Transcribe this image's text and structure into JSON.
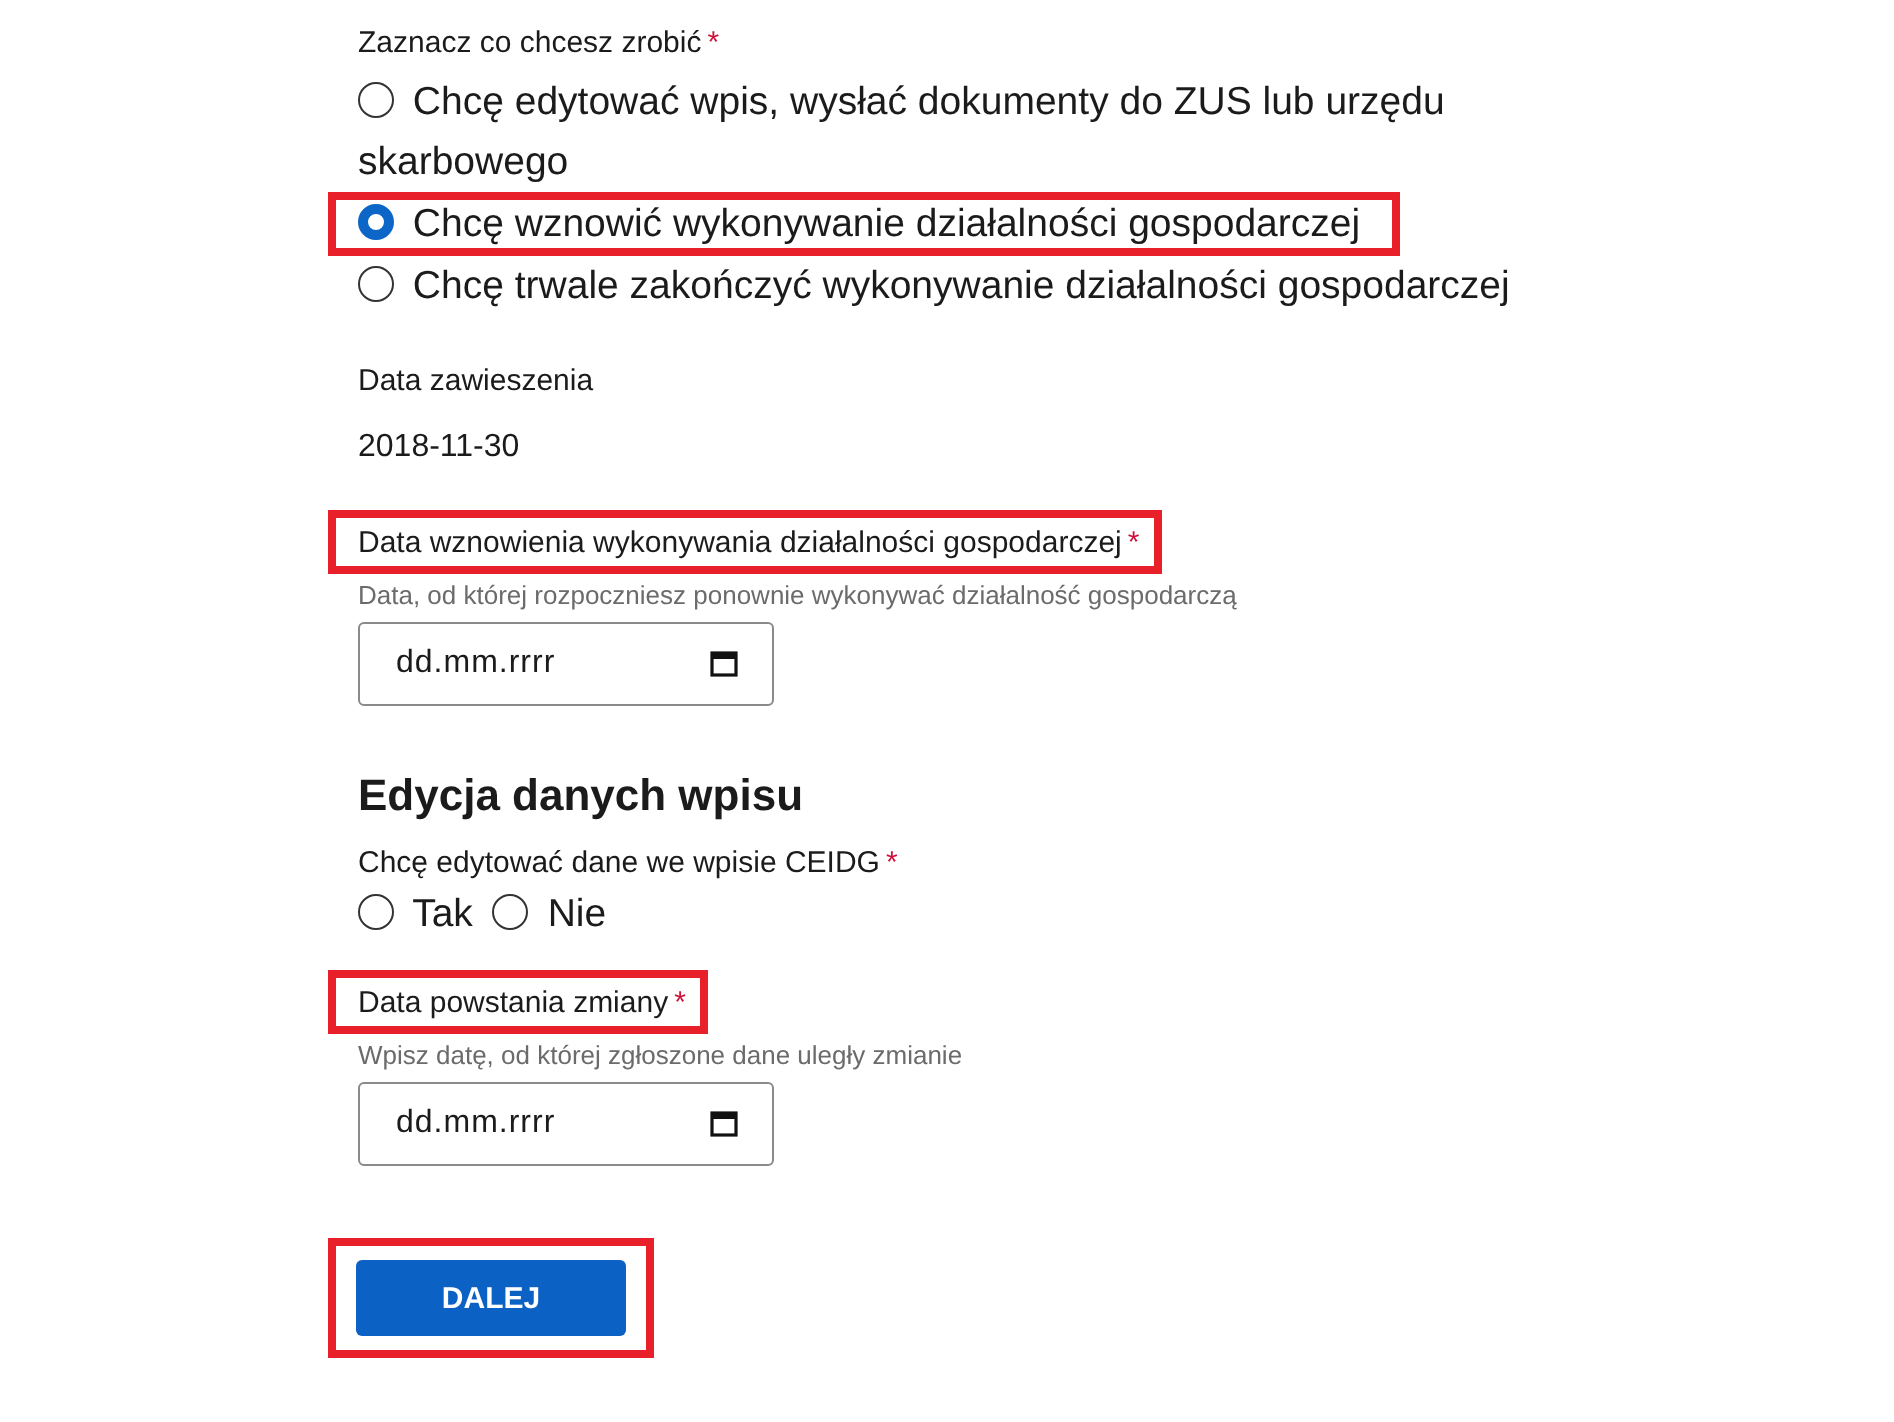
{
  "action_question": {
    "label": "Zaznacz co chcesz zrobić",
    "required_mark": "*",
    "options": [
      {
        "label": "Chcę edytować wpis, wysłać dokumenty do ZUS lub urzędu skarbowego",
        "selected": false,
        "highlighted": false
      },
      {
        "label": "Chcę wznowić wykonywanie działalności gospodarczej",
        "selected": true,
        "highlighted": true
      },
      {
        "label": "Chcę trwale zakończyć wykonywanie działalności gospodarczej",
        "selected": false,
        "highlighted": false
      }
    ]
  },
  "suspension": {
    "label": "Data zawieszenia",
    "value": "2018-11-30"
  },
  "resume_date": {
    "label": "Data wznowienia wykonywania działalności gospodarczej",
    "required_mark": "*",
    "highlighted": true,
    "hint": "Data, od której rozpoczniesz ponownie wykonywać działalność gospodarczą",
    "placeholder": "dd.mm.rrrr"
  },
  "edit_section": {
    "heading": "Edycja danych wpisu",
    "edit_question": {
      "label": "Chcę edytować dane we wpisie CEIDG",
      "required_mark": "*",
      "options": [
        {
          "label": "Tak",
          "selected": false
        },
        {
          "label": "Nie",
          "selected": false
        }
      ]
    },
    "change_date": {
      "label": "Data powstania zmiany",
      "required_mark": "*",
      "highlighted": true,
      "hint": "Wpisz datę, od której zgłoszone dane uległy zmianie",
      "placeholder": "dd.mm.rrrr"
    }
  },
  "next_button": {
    "label": "DALEJ",
    "highlighted": true
  }
}
